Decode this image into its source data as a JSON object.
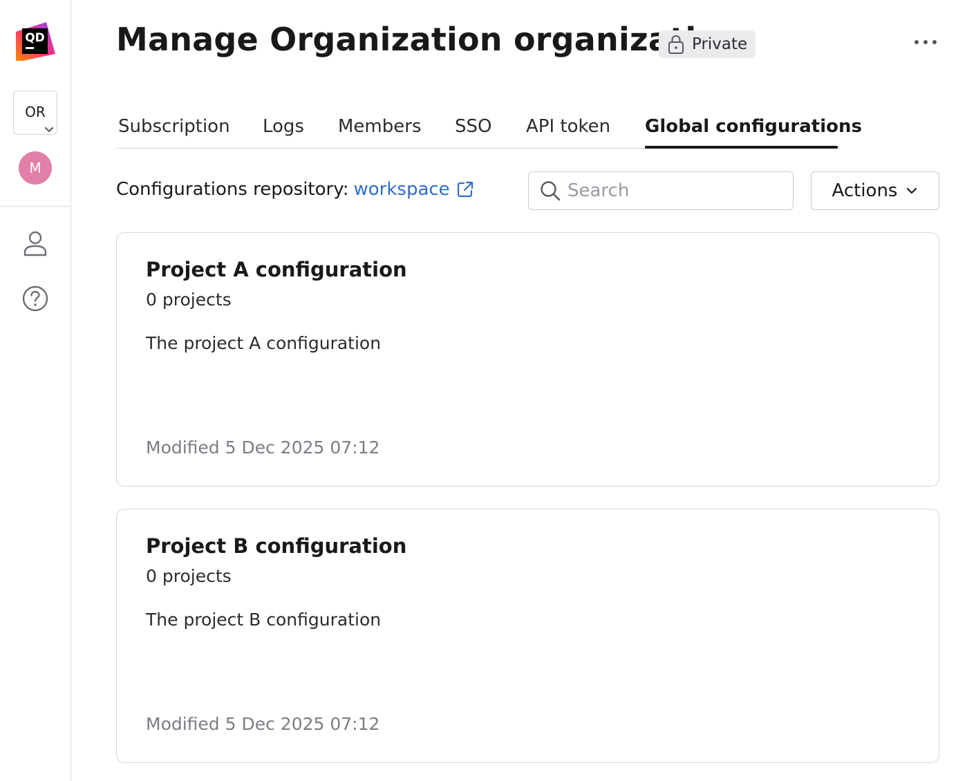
{
  "sidebar": {
    "logo_text": "QD",
    "org_switcher_label": "OR",
    "avatar_initial": "M",
    "icons": [
      "user-icon",
      "help-icon"
    ]
  },
  "header": {
    "title": "Manage Organization organization",
    "badge": "Private"
  },
  "tabs": [
    {
      "label": "Subscription",
      "active": false
    },
    {
      "label": "Logs",
      "active": false
    },
    {
      "label": "Members",
      "active": false
    },
    {
      "label": "SSO",
      "active": false
    },
    {
      "label": "API token",
      "active": false
    },
    {
      "label": "Global configurations",
      "active": true
    }
  ],
  "toolbar": {
    "repo_label": "Configurations repository:",
    "repo_link": "workspace",
    "search_placeholder": "Search",
    "actions_label": "Actions"
  },
  "configurations": [
    {
      "title": "Project A configuration",
      "count": "0 projects",
      "description": "The project A configuration",
      "modified": "Modified 5 Dec 2025 07:12"
    },
    {
      "title": "Project B configuration",
      "count": "0 projects",
      "description": "The project B configuration",
      "modified": "Modified 5 Dec 2025 07:12"
    }
  ],
  "colors": {
    "link": "#2f6ec8",
    "avatar": "#e27fa9",
    "badge_bg": "#ebebee"
  }
}
